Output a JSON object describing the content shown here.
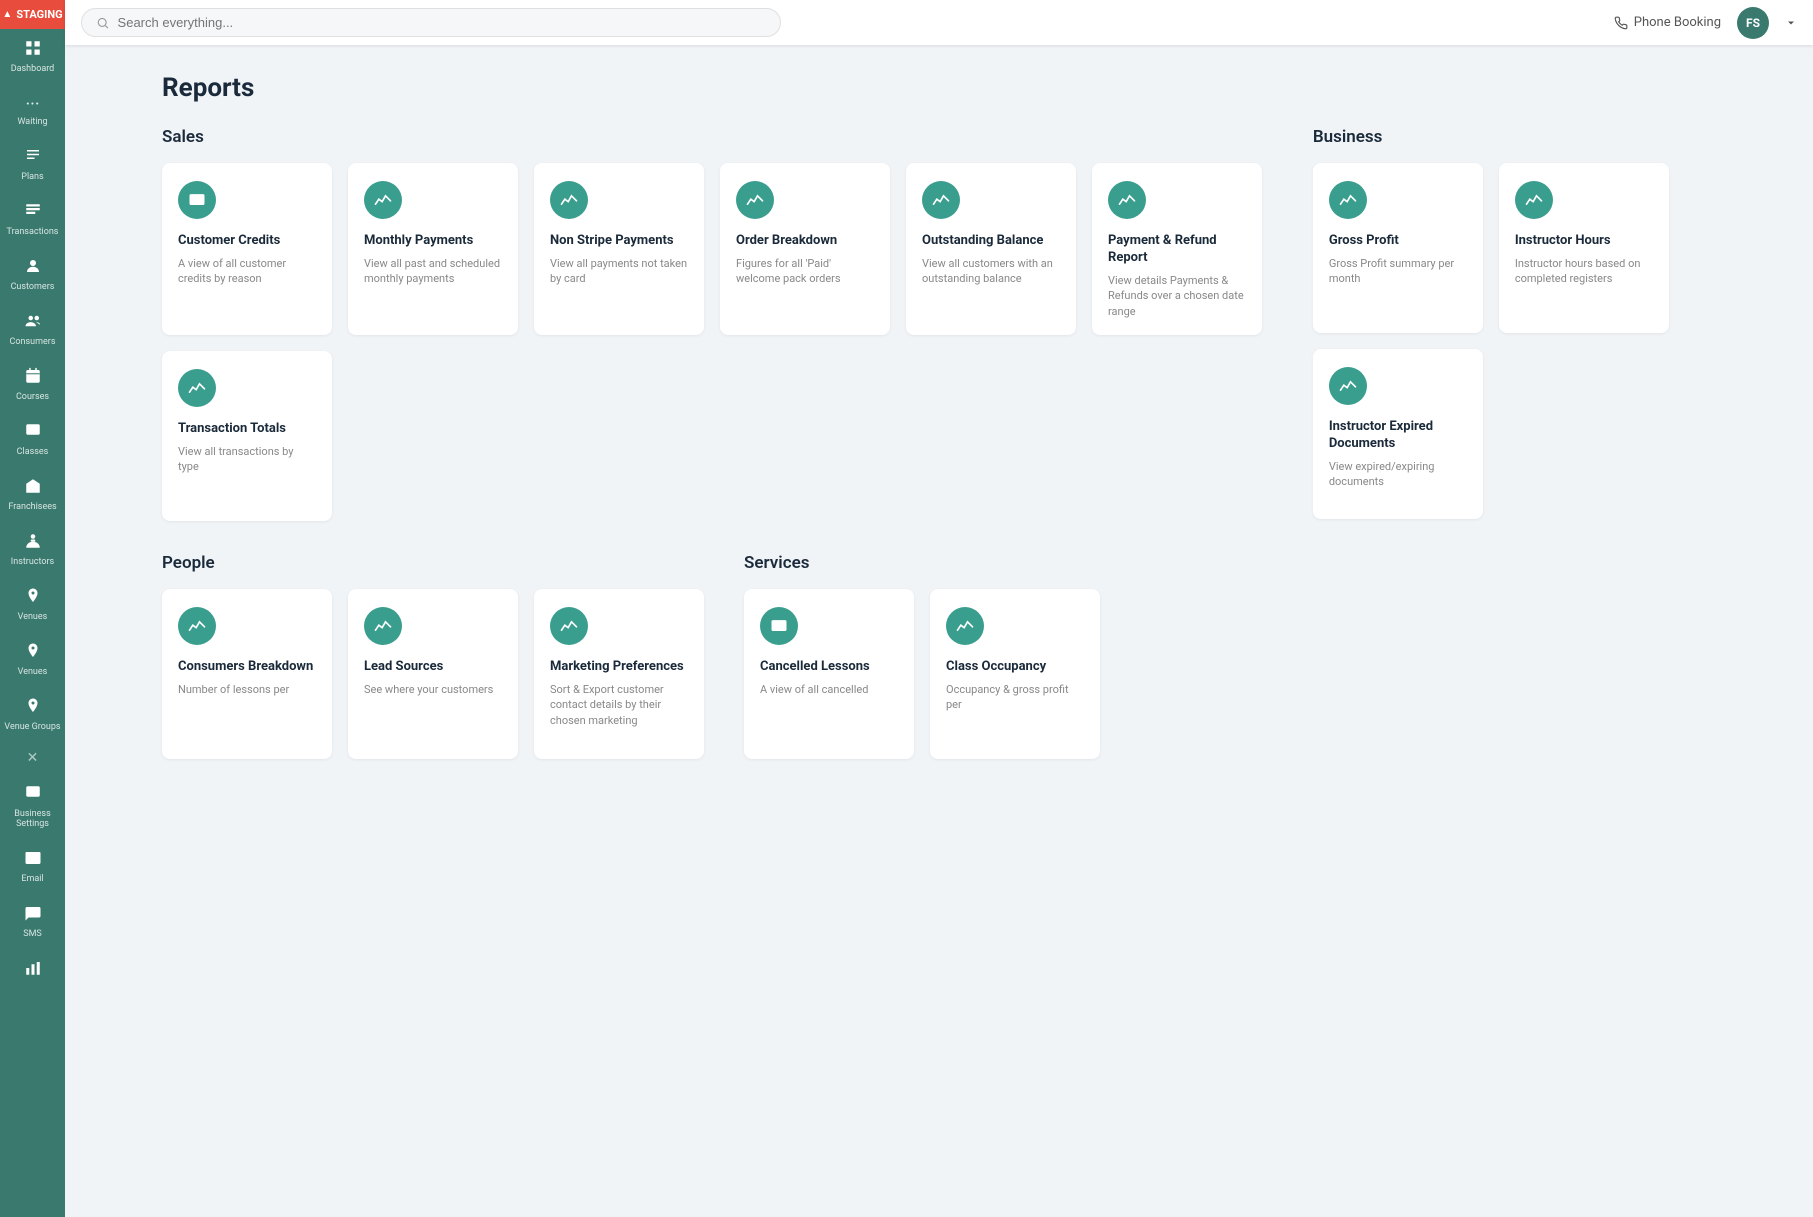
{
  "topbar": {
    "search_placeholder": "Search everything...",
    "phone_booking": "Phone Booking",
    "avatar_initials": "FS"
  },
  "sidebar": {
    "staging_label": "STAGING",
    "items": [
      {
        "id": "dashboard",
        "icon": "⊞",
        "label": "Dashboard"
      },
      {
        "id": "waiting",
        "icon": "···",
        "label": "Waiting"
      },
      {
        "id": "plans",
        "icon": "📋",
        "label": "Plans"
      },
      {
        "id": "transactions",
        "icon": "🧾",
        "label": "Transactions"
      },
      {
        "id": "customers",
        "icon": "👤",
        "label": "Customers"
      },
      {
        "id": "consumers",
        "icon": "🧑",
        "label": "Consumers"
      },
      {
        "id": "courses",
        "icon": "📅",
        "label": "Courses"
      },
      {
        "id": "classes",
        "icon": "🏫",
        "label": "Classes"
      },
      {
        "id": "franchisees",
        "icon": "🏢",
        "label": "Franchisees"
      },
      {
        "id": "instructors",
        "icon": "🎓",
        "label": "Instructors"
      },
      {
        "id": "venues",
        "icon": "📍",
        "label": "Venues"
      },
      {
        "id": "venues2",
        "icon": "📍",
        "label": "Venues"
      },
      {
        "id": "venue-groups",
        "icon": "📍",
        "label": "Venue Groups"
      },
      {
        "id": "business-settings",
        "icon": "🔧",
        "label": "Business Settings"
      },
      {
        "id": "email",
        "icon": "✉️",
        "label": "Email"
      },
      {
        "id": "sms",
        "icon": "💬",
        "label": "SMS"
      },
      {
        "id": "reports",
        "icon": "📊",
        "label": ""
      }
    ]
  },
  "page": {
    "title": "Reports"
  },
  "sections": {
    "sales": {
      "title": "Sales",
      "cards": [
        {
          "id": "customer-credits",
          "title": "Customer Credits",
          "desc": "A view of all customer credits by reason"
        },
        {
          "id": "monthly-payments",
          "title": "Monthly Payments",
          "desc": "View all past and scheduled monthly payments"
        },
        {
          "id": "non-stripe-payments",
          "title": "Non Stripe Payments",
          "desc": "View all payments not taken by card"
        },
        {
          "id": "order-breakdown",
          "title": "Order Breakdown",
          "desc": "Figures for all 'Paid' welcome pack orders"
        },
        {
          "id": "outstanding-balance",
          "title": "Outstanding Balance",
          "desc": "View all customers with an outstanding balance"
        },
        {
          "id": "payment-refund-report",
          "title": "Payment & Refund Report",
          "desc": "View details Payments & Refunds over a chosen date range"
        },
        {
          "id": "transaction-totals",
          "title": "Transaction Totals",
          "desc": "View all transactions by type"
        }
      ]
    },
    "business": {
      "title": "Business",
      "cards": [
        {
          "id": "gross-profit",
          "title": "Gross Profit",
          "desc": "Gross Profit summary per month"
        },
        {
          "id": "instructor-hours",
          "title": "Instructor Hours",
          "desc": "Instructor hours based on completed registers"
        },
        {
          "id": "instructor-expired-docs",
          "title": "Instructor Expired Documents",
          "desc": "View expired/expiring documents"
        }
      ]
    },
    "people": {
      "title": "People",
      "cards": [
        {
          "id": "consumers-breakdown",
          "title": "Consumers Breakdown",
          "desc": "Number of lessons per"
        },
        {
          "id": "lead-sources",
          "title": "Lead Sources",
          "desc": "See where your customers"
        },
        {
          "id": "marketing-preferences",
          "title": "Marketing Preferences",
          "desc": "Sort & Export customer contact details by their chosen marketing"
        }
      ]
    },
    "services": {
      "title": "Services",
      "cards": [
        {
          "id": "cancelled-lessons",
          "title": "Cancelled Lessons",
          "desc": "A view of all cancelled"
        },
        {
          "id": "class-occupancy",
          "title": "Class Occupancy",
          "desc": "Occupancy & gross profit per"
        }
      ]
    }
  }
}
